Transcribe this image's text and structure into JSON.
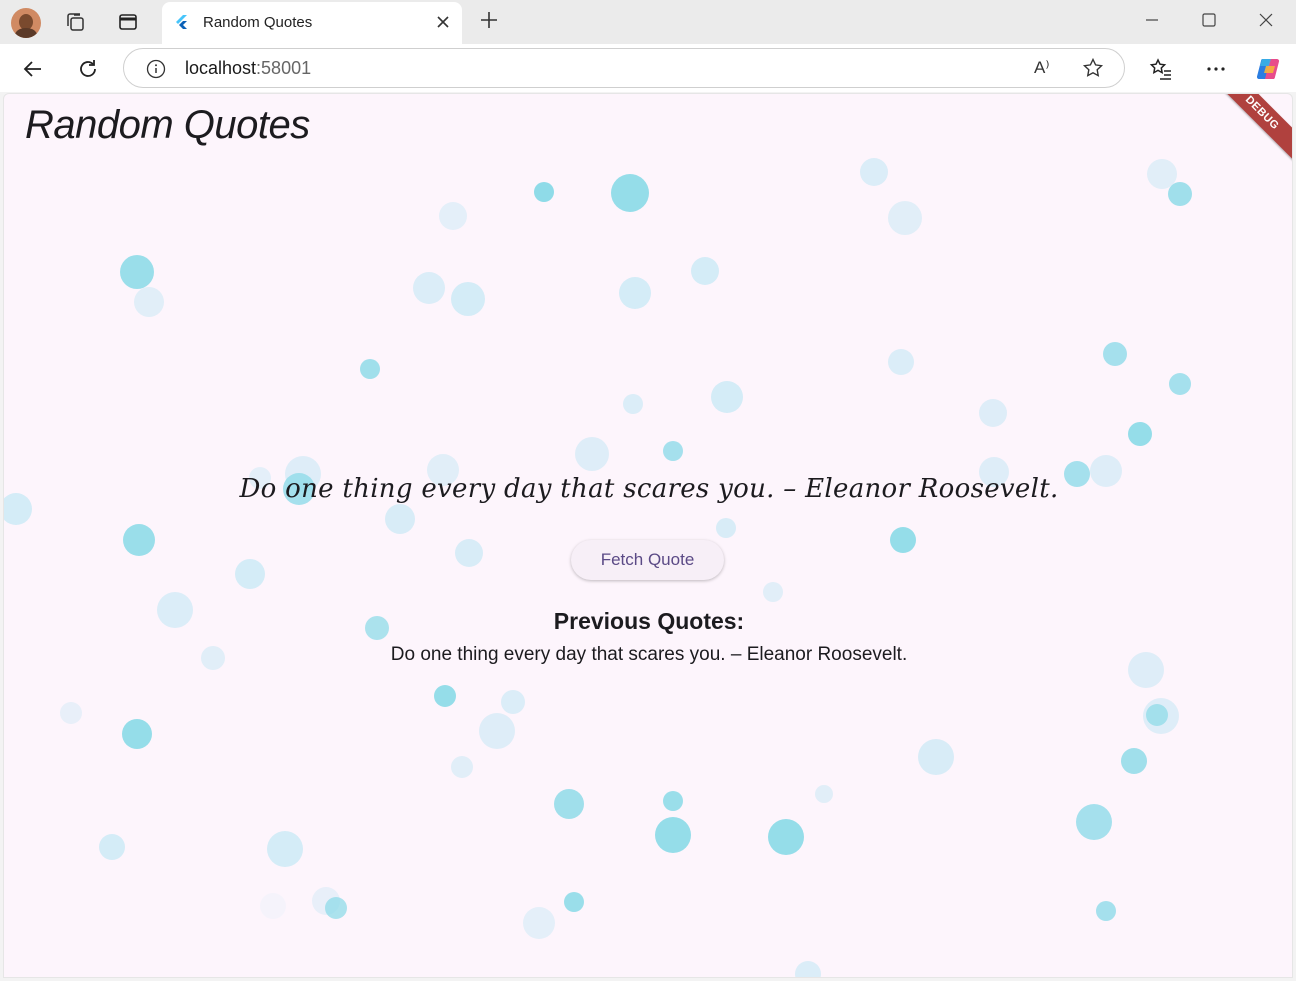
{
  "browser": {
    "tab_title": "Random Quotes",
    "url_host": "localhost",
    "url_port": ":58001",
    "read_aloud_label": "A⁾"
  },
  "app": {
    "title": "Random Quotes",
    "debug_label": "DEBUG",
    "current_quote": "Do one thing every day that scares you. – Eleanor Roosevelt.",
    "fetch_button_label": "Fetch Quote",
    "previous_heading": "Previous Quotes:",
    "previous_quotes": [
      "Do one thing every day that scares you. – Eleanor Roosevelt."
    ]
  },
  "colors": {
    "page_background": "#fdf5fc",
    "bubble_strong": "#8fdbe8",
    "bubble_light": "#bfe6f4",
    "debug_ribbon": "#b0413e",
    "button_text": "#5b4a86"
  }
}
